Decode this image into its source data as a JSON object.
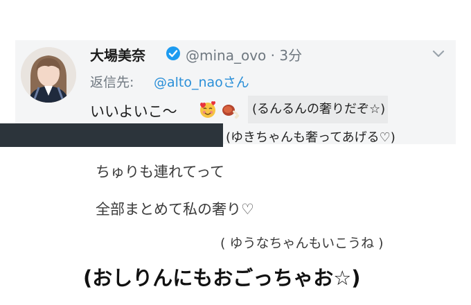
{
  "tweet": {
    "display_name": "大場美奈",
    "handle_time": "@mina_ovo · 3分",
    "reply_label": "返信先:",
    "reply_to": "@alto_naoさん",
    "text": "いいよいこ〜",
    "emojis": [
      "smiling-face-with-hearts-icon",
      "meat-on-bone-icon"
    ]
  },
  "annotations": {
    "note1": "(るんるんの奢りだぞ☆)",
    "note2": "(ゆきちゃんも奢ってあげる♡)",
    "line1": "ちゅりも連れてって",
    "line2": "全部まとめて私の奢り♡",
    "line3": "( ゆうなちゃんもいこうね )",
    "line4": "(おしりんにもおごっちゃお☆)"
  },
  "colors": {
    "verified": "#1d9bf0",
    "link": "#2a8fd8",
    "redaction": "#2c343b",
    "card_bg": "#f4f5f6"
  }
}
